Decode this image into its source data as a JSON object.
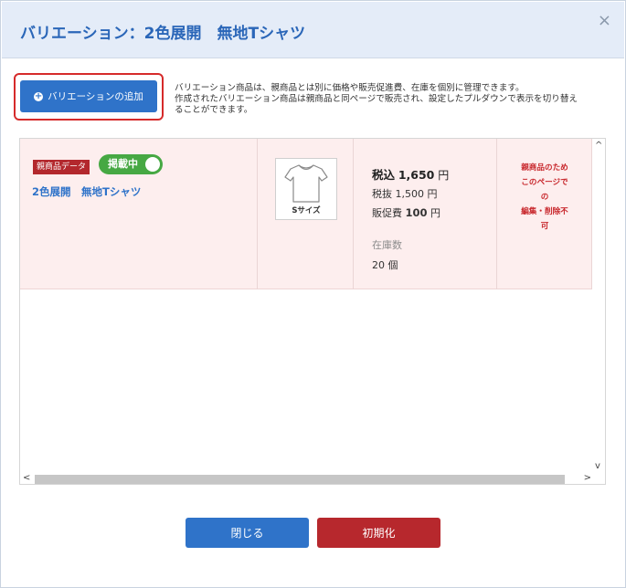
{
  "modal": {
    "title": "バリエーション：2色展開　無地Tシャツ",
    "close_icon": "×"
  },
  "add_button": {
    "icon": "plus-circle-icon",
    "label": "バリエーションの追加"
  },
  "description": [
    "バリエーション商品は、親商品とは別に価格や販売促進費、在庫を個別に管理できます。",
    "作成されたバリエーション商品は親商品と同ページで販売され、設定したプルダウンで表示を切り替え",
    "ることができます。"
  ],
  "row": {
    "parent_badge": "親商品データ",
    "status_toggle": {
      "label": "掲載中",
      "on": true
    },
    "product_name": "2色展開　無地Tシャツ",
    "thumbnail": {
      "icon": "tshirt-icon",
      "size_label": "Sサイズ"
    },
    "price": {
      "incl_prefix": "税込",
      "incl_value": "1,650",
      "incl_unit": "円",
      "excl_text": "税抜 1,500 円",
      "promo_prefix": "販促費",
      "promo_value": "100",
      "promo_unit": "円"
    },
    "stock": {
      "label": "在庫数",
      "value": "20 個"
    },
    "note_lines": [
      "親商品のため",
      "このページで",
      "の",
      "編集・削除不",
      "可"
    ]
  },
  "scrollbar": {
    "up": "^",
    "down": "v",
    "left": "<",
    "right": ">"
  },
  "footer": {
    "close_label": "閉じる",
    "reset_label": "初期化"
  },
  "colors": {
    "accent_blue": "#2f73c9",
    "danger_red": "#b7282d",
    "toggle_green": "#46a843",
    "row_bg": "#fdeeee"
  }
}
